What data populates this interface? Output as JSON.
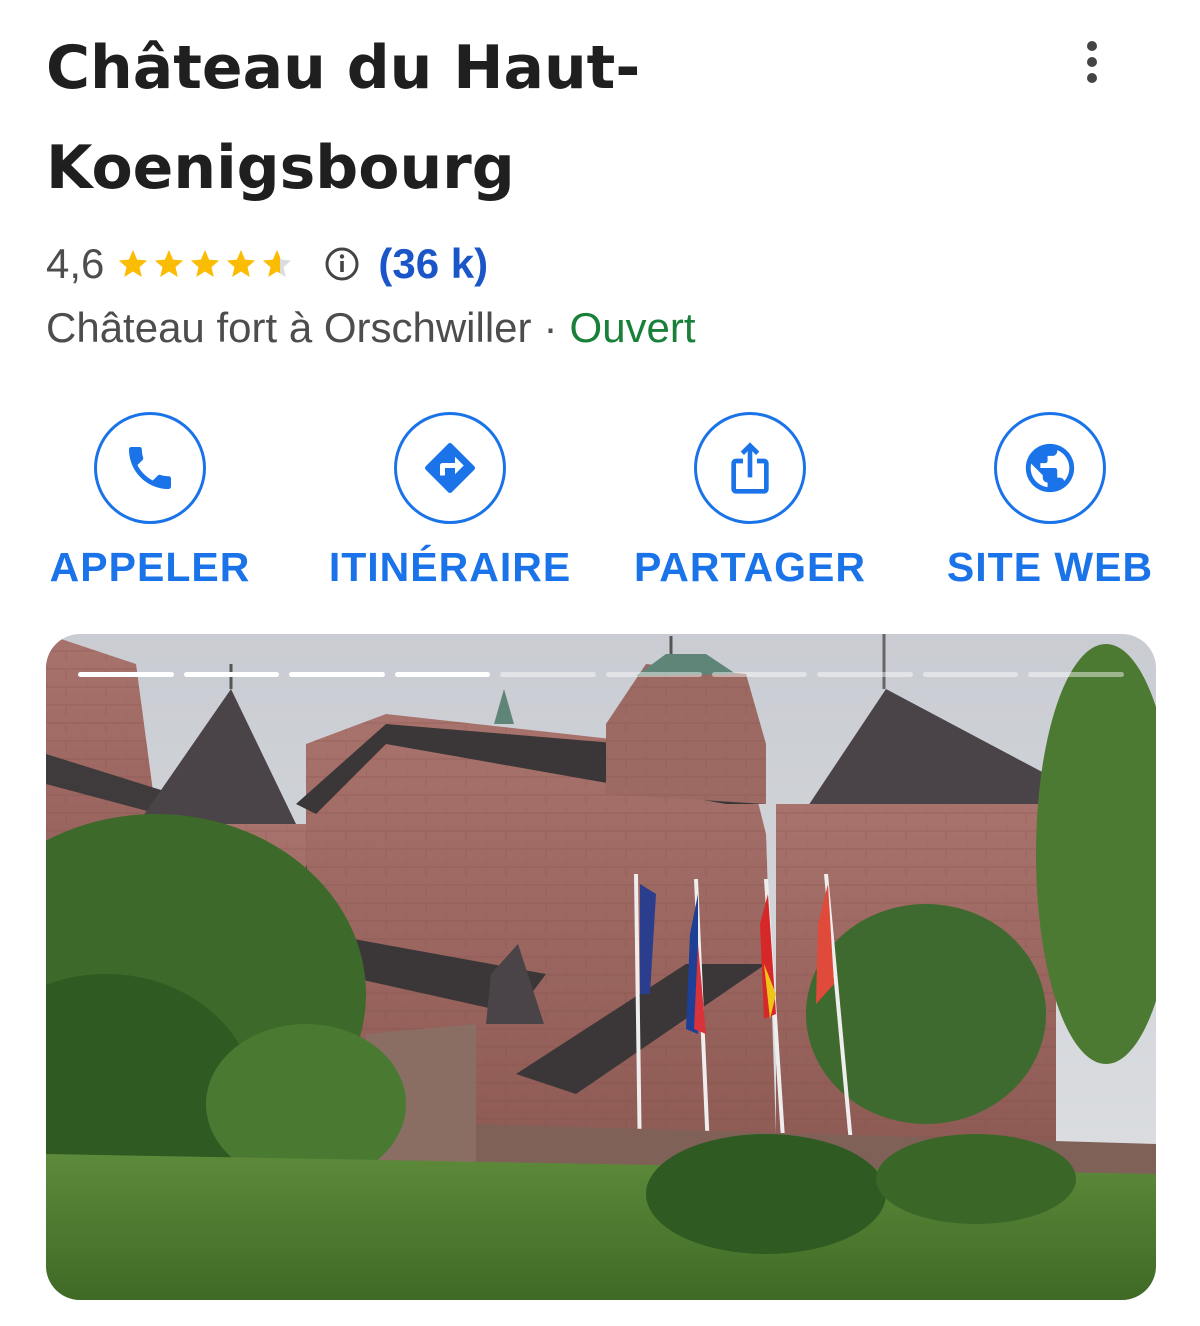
{
  "place": {
    "title": "Château du Haut-Koenigsbourg",
    "rating_value": "4,6",
    "rating_stars": 4.6,
    "reviews_count": "(36 k)",
    "category": "Château fort à Orschwiller",
    "separator": "·",
    "status": "Ouvert"
  },
  "actions": [
    {
      "label": "APPELER",
      "icon": "phone-icon"
    },
    {
      "label": "ITINÉRAIRE",
      "icon": "directions-icon"
    },
    {
      "label": "PARTAGER",
      "icon": "share-icon"
    },
    {
      "label": "SITE WEB",
      "icon": "globe-icon"
    }
  ],
  "photo": {
    "total_slides": 10,
    "completed_slides": 4
  },
  "colors": {
    "accent": "#1a73e8",
    "star": "#fbbc04",
    "open": "#188038",
    "reviews": "#1a56c8"
  }
}
